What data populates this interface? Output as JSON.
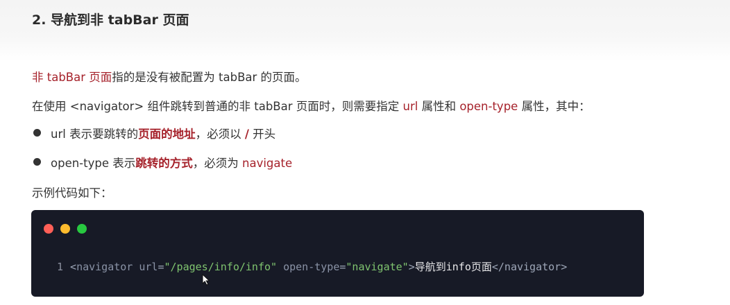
{
  "title": "2. 导航到非 tabBar 页面",
  "p1": {
    "hl": "非 tabBar 页面",
    "rest": "指的是没有被配置为 tabBar 的页面。"
  },
  "p2": {
    "a": "在使用 <navigator> 组件跳转到普通的非 tabBar 页面时，则需要指定 ",
    "b": "url",
    "c": " 属性和 ",
    "d": "open-type",
    "e": " 属性，其中："
  },
  "bullets": [
    {
      "a": "url 表示要跳转的",
      "b": "页面的地址",
      "c": "，必须以 ",
      "d": "/",
      "e": " 开头"
    },
    {
      "a": "open-type 表示",
      "b": "跳转的方式",
      "c": "，必须为 ",
      "d": "navigate",
      "e": ""
    }
  ],
  "p3": "示例代码如下：",
  "code": {
    "dots": [
      "#ff5f57",
      "#febc2e",
      "#28c840"
    ],
    "line_no": "1",
    "t_open": "<",
    "t_name": "navigator",
    "a1": " url",
    "eq1": "=",
    "v1": "\"/pages/info/info\"",
    "a2": " open-type",
    "eq2": "=",
    "v2": "\"navigate\"",
    "gt": ">",
    "inner": "导航到info页面",
    "close": "</navigator>"
  }
}
